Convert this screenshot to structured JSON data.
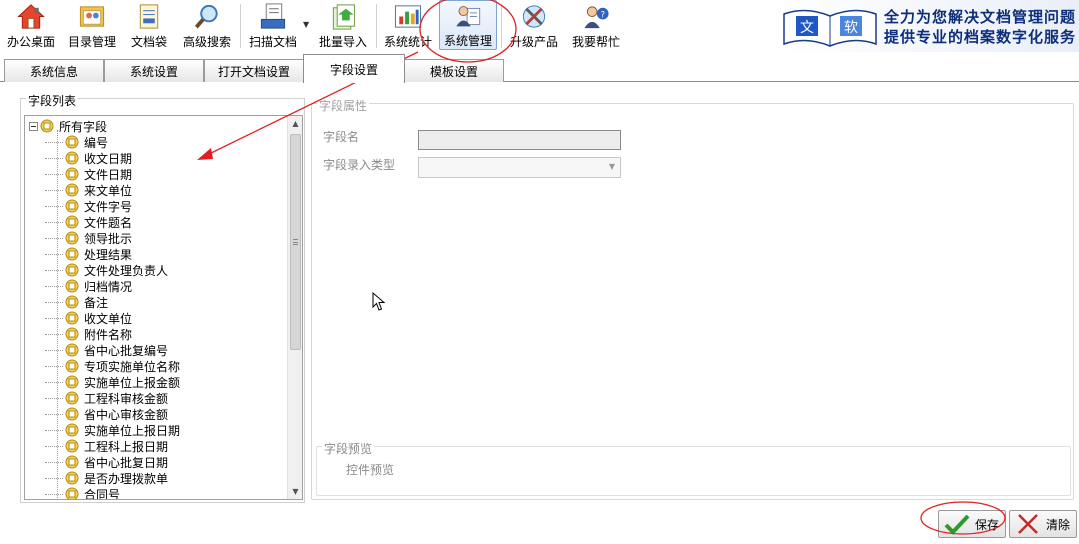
{
  "toolbar": {
    "items": [
      {
        "label": "办公桌面",
        "icon": "house-icon"
      },
      {
        "label": "目录管理",
        "icon": "catalog-icon"
      },
      {
        "label": "文档袋",
        "icon": "document-bag-icon"
      },
      {
        "label": "高级搜索",
        "icon": "magnifier-icon"
      },
      {
        "label": "扫描文档",
        "icon": "scanner-icon"
      },
      {
        "label": "批量导入",
        "icon": "batch-import-icon"
      },
      {
        "label": "系统统计",
        "icon": "bar-chart-icon"
      },
      {
        "label": "系统管理",
        "icon": "admin-user-icon"
      },
      {
        "label": "升级产品",
        "icon": "upgrade-tools-icon"
      },
      {
        "label": "我要帮忙",
        "icon": "help-user-icon"
      }
    ],
    "active_item": "系统管理"
  },
  "banner": {
    "logo_text_1": "文",
    "logo_text_2": "软",
    "line1": "全力为您解决文档管理问题",
    "line2": "提供专业的档案数字化服务"
  },
  "tabs": [
    {
      "label": "系统信息"
    },
    {
      "label": "系统设置"
    },
    {
      "label": "打开文档设置"
    },
    {
      "label": "字段设置"
    },
    {
      "label": "模板设置"
    }
  ],
  "active_tab": "字段设置",
  "field_list": {
    "title": "字段列表",
    "root": "所有字段",
    "items": [
      "编号",
      "收文日期",
      "文件日期",
      "来文单位",
      "文件字号",
      "文件题名",
      "领导批示",
      "处理结果",
      "文件处理负责人",
      "归档情况",
      "备注",
      "收文单位",
      "附件名称",
      "省中心批复编号",
      "专项实施单位名称",
      "实施单位上报金额",
      "工程科审核金额",
      "省中心审核金额",
      "实施单位上报日期",
      "工程科上报日期",
      "省中心批复日期",
      "是否办理拨款单",
      "合同号"
    ]
  },
  "properties": {
    "title": "字段属性",
    "field_name_label": "字段名",
    "field_name_value": "",
    "input_type_label": "字段录入类型",
    "input_type_value": ""
  },
  "preview": {
    "title": "字段预览",
    "control_text": "控件预览"
  },
  "buttons": {
    "save": "保存",
    "clear": "清除"
  },
  "colors": {
    "annotation_red": "#e02020",
    "active_tab_border": "#8c8c8c",
    "banner_text": "#0d2e7a"
  }
}
